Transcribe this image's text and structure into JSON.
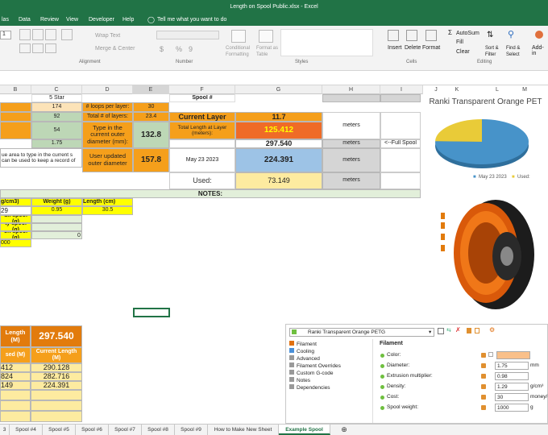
{
  "window": {
    "title": "Length on Spool Public.xlsx  -  Excel"
  },
  "menu": [
    "las",
    "Data",
    "Review",
    "View",
    "Developer",
    "Help"
  ],
  "tell_me": "Tell me what you want to do",
  "ribbon": {
    "wrap_text": "Wrap Text",
    "merge_center": "Merge & Center",
    "group_alignment": "Alignment",
    "currency": "$",
    "percent": "%",
    "comma": "9",
    "group_number": "Number",
    "cond_format": "Conditional Formatting",
    "format_table": "Format as Table",
    "group_styles": "Styles",
    "insert": "Insert",
    "delete": "Delete",
    "format": "Format",
    "group_cells": "Cells",
    "autosum": "AutoSum",
    "fill": "Fill",
    "clear": "Clear",
    "sort_filter": "Sort & Filter",
    "find_select": "Find & Select",
    "group_editing": "Editing",
    "addins": "Add-in",
    "font_size": "1"
  },
  "columns": [
    "B",
    "C",
    "D",
    "E",
    "F",
    "G",
    "H",
    "I",
    "J",
    "K",
    "L",
    "M"
  ],
  "cells": {
    "c_5star": "5 Star",
    "spool_hash": "Spool #",
    "c174": "174",
    "loops_label": "# loops per layer:",
    "e30": "30",
    "c92": "92",
    "total_layers_label": "Total # of layers:",
    "e23": "23.4",
    "current_layer_label": "Current Layer",
    "current_layer_val": "11.7",
    "c54": "54",
    "type_current_outer": "Type in the current outer diameter (mm):",
    "e132": "132.8",
    "total_length_label": "Total Length at Layer (meters):",
    "total_length_val": "125.412",
    "meters1": "meters",
    "c175": "1.75",
    "g297": "297.540",
    "meters2": "meters",
    "full_spool": "<--Full Spool",
    "left_note": "ue area to type in the current s can be used to keep a record of",
    "user_updated": "User updated outer diameter",
    "e157": "157.8",
    "date": "May 23 2023",
    "g224": "224.391",
    "meters3": "meters",
    "used_label": "Used:",
    "g73": "73.149",
    "meters4": "meters",
    "notes": "NOTES:",
    "density_hdr": "g/cm3)",
    "weight_hdr": "Weight (g)",
    "length_hdr": "Length (cm)",
    "b29": "29",
    "c095": "0.95",
    "d305": "30.5",
    "full_spool_g": "ull spool (g)",
    "empty_spool_g": "ty spool (g)",
    "on_spool_g": "on spool (g)",
    "d0": "0",
    "b000": "000"
  },
  "summary": {
    "length_hdr": "Length (M)",
    "big_val": "297.540",
    "used_hdr": "sed (M)",
    "current_hdr": "Current Length (M)",
    "rows": [
      {
        "a": "412",
        "b": "290.128"
      },
      {
        "a": "824",
        "b": "282.716"
      },
      {
        "a": "149",
        "b": "224.391"
      }
    ]
  },
  "chart": {
    "title": "Ranki Transparent Orange PET",
    "legend_date": "May 23 2023",
    "legend_used": "Used:",
    "colors": {
      "remaining": "#4793c9",
      "used": "#e9cb38"
    }
  },
  "chart_data": {
    "type": "pie",
    "title": "Ranki Transparent Orange PET",
    "categories": [
      "May 23 2023",
      "Used:"
    ],
    "values": [
      224.391,
      73.149
    ],
    "legend": "bottom"
  },
  "slicer": {
    "profile": "Ranki Transparent Orange PETG",
    "categories": [
      "Filament",
      "Cooling",
      "Advanced",
      "Filament Overrides",
      "Custom G-code",
      "Notes",
      "Dependencies"
    ],
    "section": "Filament",
    "fields": [
      {
        "label": "Color:",
        "value": "",
        "unit": ""
      },
      {
        "label": "Diameter:",
        "value": "1.75",
        "unit": "mm"
      },
      {
        "label": "Extrusion multiplier:",
        "value": "0.98",
        "unit": ""
      },
      {
        "label": "Density:",
        "value": "1.29",
        "unit": "g/cm³"
      },
      {
        "label": "Cost:",
        "value": "30",
        "unit": "money/"
      },
      {
        "label": "Spool weight:",
        "value": "1000",
        "unit": "g"
      }
    ],
    "color_swatch": "#f9c08a"
  },
  "sheet_tabs": [
    "3",
    "Spool #4",
    "Spool #5",
    "Spool #6",
    "Spool #7",
    "Spool #8",
    "Spool #9",
    "How to Make New Sheet",
    "Example Spool"
  ],
  "active_tab": "Example Spool"
}
